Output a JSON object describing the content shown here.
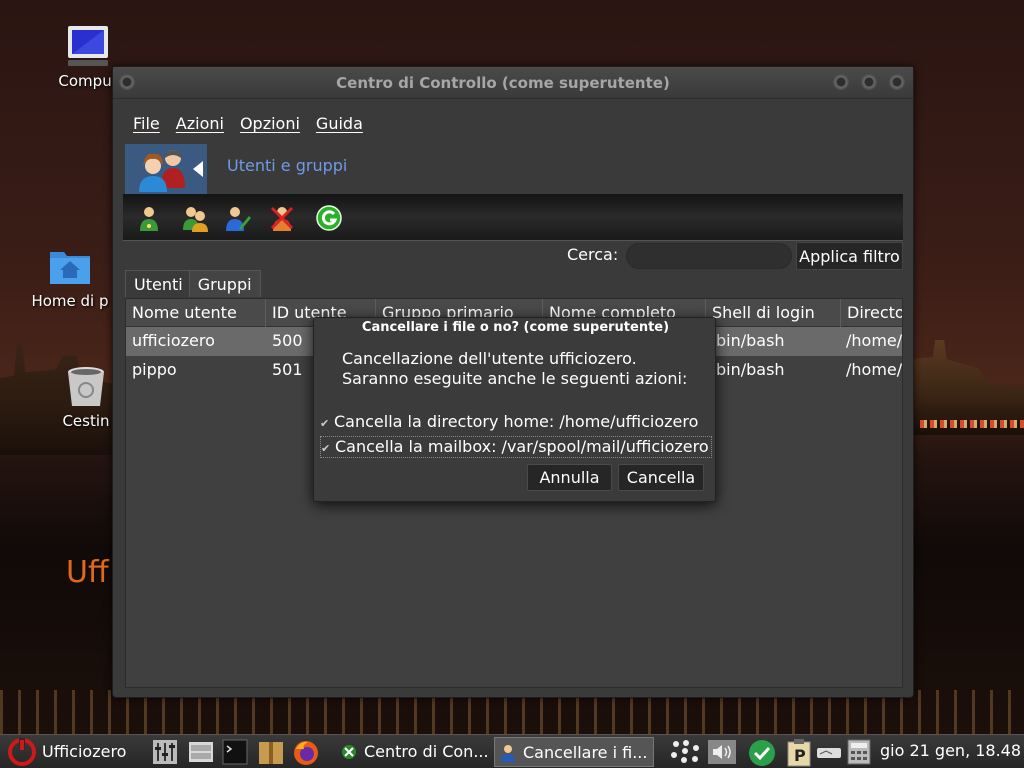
{
  "desktop": {
    "icons": [
      {
        "label": "Comput"
      },
      {
        "label": "Home di p"
      },
      {
        "label": "Cestin"
      }
    ],
    "brand": "Uff"
  },
  "window": {
    "title": "Centro di Controllo (come superutente)",
    "menu": [
      "File",
      "Azioni",
      "Opzioni",
      "Guida"
    ],
    "section_label": "Utenti e gruppi",
    "toolbar_icons": [
      "add-user-icon",
      "add-group-icon",
      "edit-user-icon",
      "delete-user-icon",
      "refresh-icon"
    ],
    "search": {
      "label": "Cerca:",
      "value": "",
      "placeholder": ""
    },
    "filter_button": "Applica filtro",
    "tabs": [
      "Utenti",
      "Gruppi"
    ],
    "columns": [
      "Nome utente",
      "ID utente",
      "Gruppo primario",
      "Nome completo",
      "Shell di login",
      "Directo"
    ],
    "rows": [
      {
        "name": "ufficiozero",
        "id": "500",
        "shell": "bin/bash",
        "dir": "/home/",
        "selected": true
      },
      {
        "name": "pippo",
        "id": "501",
        "shell": "bin/bash",
        "dir": "/home/",
        "selected": false
      }
    ]
  },
  "dialog": {
    "title": "Cancellare i file o no? (come superutente)",
    "message_line1": "Cancellazione dell'utente ufficiozero.",
    "message_line2": "Saranno eseguite anche le seguenti azioni:",
    "options": [
      {
        "label": "Cancella la directory home: /home/ufficiozero",
        "checked": true
      },
      {
        "label": "Cancella la mailbox: /var/spool/mail/ufficiozero",
        "checked": true
      }
    ],
    "cancel_button": "Annulla",
    "confirm_button": "Cancella"
  },
  "taskbar": {
    "start_label": "Ufficiozero",
    "tasks": [
      {
        "label": "Centro di Con..."
      },
      {
        "label": "Cancellare i fi..."
      }
    ],
    "clock": "gio 21 gen, 18.48"
  },
  "colors": {
    "link_blue": "#6f9be6",
    "accent_orange": "#e06a1a",
    "window_bg": "#3a3a3a"
  }
}
